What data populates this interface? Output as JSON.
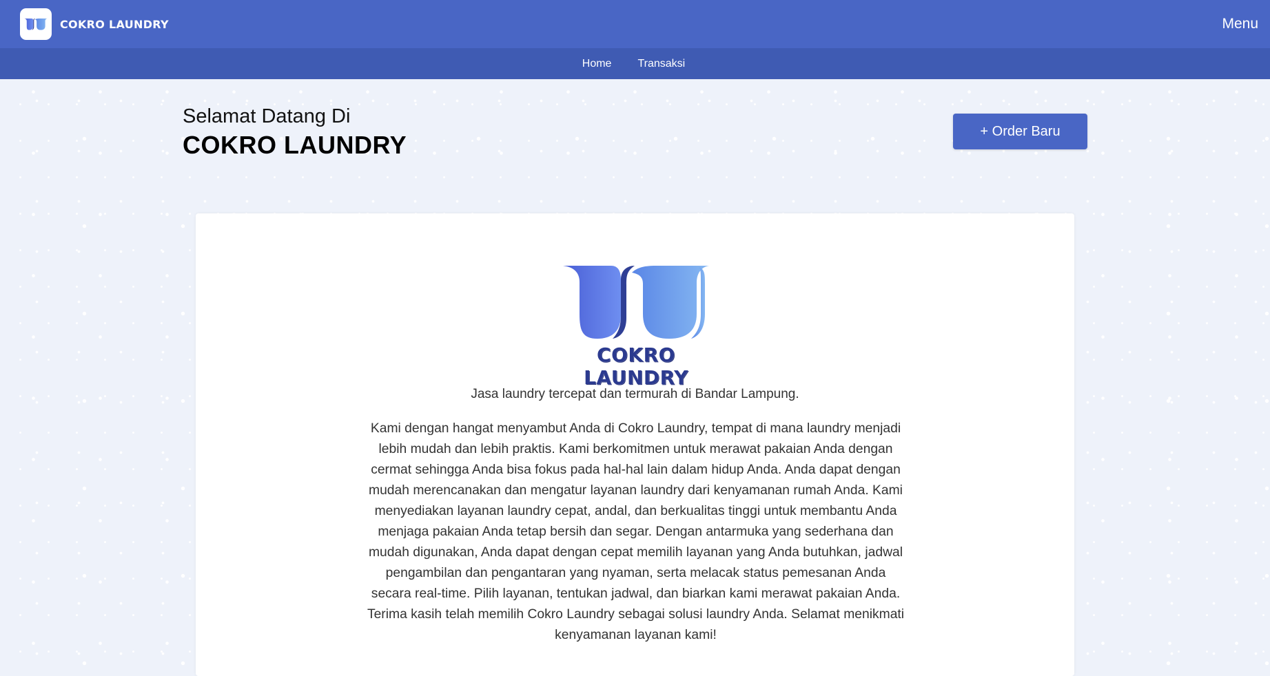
{
  "header": {
    "brand_name": "COKRO LAUNDRY",
    "menu_label": "Menu",
    "bg_color": "#4966c5"
  },
  "subnav": {
    "items": [
      "Home",
      "Transaksi"
    ],
    "bg_color": "#3f5bb3"
  },
  "welcome": {
    "line1": "Selamat Datang Di",
    "line2": "COKRO LAUNDRY"
  },
  "order_button": {
    "label": "+ Order Baru",
    "color": "#4966c5"
  },
  "card": {
    "logo_text": "COKRO LAUNDRY",
    "tagline": "Jasa laundry tercepat dan termurah di Bandar Lampung.",
    "description": "Kami dengan hangat menyambut Anda di Cokro Laundry, tempat di mana laundry menjadi lebih mudah dan lebih praktis. Kami berkomitmen untuk merawat pakaian Anda dengan cermat sehingga Anda bisa fokus pada hal-hal lain dalam hidup Anda. Anda dapat dengan mudah merencanakan dan mengatur layanan laundry dari kenyamanan rumah Anda. Kami menyediakan layanan laundry cepat, andal, dan berkualitas tinggi untuk membantu Anda menjaga pakaian Anda tetap bersih dan segar. Dengan antarmuka yang sederhana dan mudah digunakan, Anda dapat dengan cepat memilih layanan yang Anda butuhkan, jadwal pengambilan dan pengantaran yang nyaman, serta melacak status pemesanan Anda secara real-time. Pilih layanan, tentukan jadwal, dan biarkan kami merawat pakaian Anda. Terima kasih telah memilih Cokro Laundry sebagai solusi laundry Anda. Selamat menikmati kenyamanan layanan kami!"
  }
}
